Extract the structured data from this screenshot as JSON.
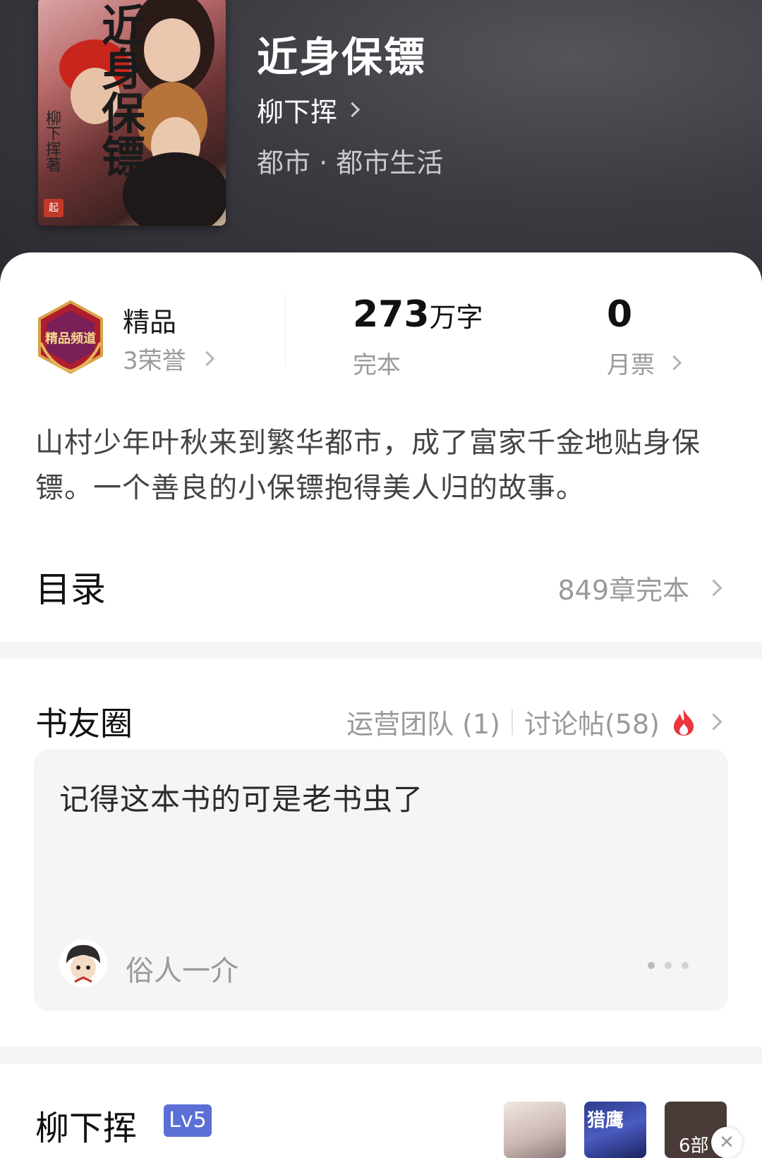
{
  "book": {
    "title": "近身保镖",
    "author": "柳下挥",
    "genre": "都市 · 都市生活",
    "cover": {
      "title": "近身保镖",
      "author": "柳下挥著",
      "seal": "起"
    }
  },
  "stats": {
    "channel_label": "精品",
    "honors": "3荣誉",
    "badge_text": "精品频道",
    "word_count": "273",
    "word_unit": "万字",
    "status": "完本",
    "monthly_votes": "0",
    "monthly_votes_label": "月票"
  },
  "synopsis": "山村少年叶秋来到繁华都市，成了富家千金地贴身保镖。一个善良的小保镖抱得美人归的故事。",
  "toc": {
    "title": "目录",
    "meta": "849章完本"
  },
  "book_circle": {
    "title": "书友圈",
    "ops_team": "运营团队 (1)",
    "discussions": "讨论帖(58)",
    "post": {
      "text": "记得这本书的可是老书虫了",
      "user": "俗人一介"
    }
  },
  "author_section": {
    "name": "柳下挥",
    "level": "Lv5",
    "thumb2_title": "猎鹰",
    "more_label": "6部"
  },
  "colors": {
    "header_bg": "#3c3b42",
    "level_badge": "#5b6fd6",
    "fire": "#e8363c"
  }
}
